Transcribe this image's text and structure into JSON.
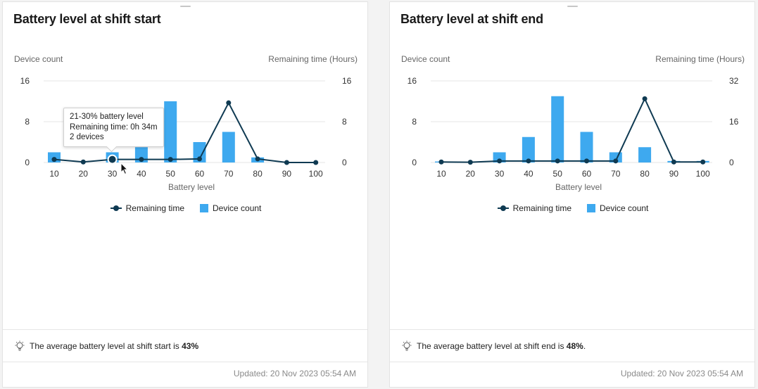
{
  "colors": {
    "bar": "#3ea9ef",
    "line": "#0f3a52",
    "axis_text": "#666666",
    "grid": "#e6e6e6"
  },
  "cards": [
    {
      "title": "Battery level at shift start",
      "chart_data": {
        "type": "bar",
        "x_axis_label": "Battery level",
        "left_axis_label": "Device count",
        "right_axis_label": "Remaining time (Hours)",
        "categories": [
          "10",
          "20",
          "30",
          "40",
          "50",
          "60",
          "70",
          "80",
          "90",
          "100"
        ],
        "left_ylim": [
          0,
          16
        ],
        "left_ticks": [
          "0",
          "8",
          "16"
        ],
        "right_ylim": [
          0,
          16
        ],
        "right_ticks": [
          "0",
          "8",
          "16"
        ],
        "series": [
          {
            "name": "Device count",
            "type": "bar",
            "axis": "left",
            "values": [
              2,
              0,
              2,
              3,
              12,
              4,
              6,
              1,
              0,
              0
            ]
          },
          {
            "name": "Remaining time",
            "type": "line",
            "axis": "right",
            "values": [
              0.6,
              0.1,
              0.6,
              0.6,
              0.6,
              0.7,
              11.7,
              0.7,
              0,
              0
            ]
          }
        ]
      },
      "legend": [
        "Remaining time",
        "Device count"
      ],
      "insight_prefix": "The average battery level at shift start is ",
      "insight_value": "43%",
      "insight_suffix": "",
      "updated": "Updated: 20 Nov 2023 05:54 AM",
      "tooltip": {
        "line1": "21-30% battery level",
        "line2": "Remaining time: 0h 34m",
        "line3": "2 devices"
      }
    },
    {
      "title": "Battery level at shift end",
      "chart_data": {
        "type": "bar",
        "x_axis_label": "Battery level",
        "left_axis_label": "Device count",
        "right_axis_label": "Remaining time (Hours)",
        "categories": [
          "10",
          "20",
          "30",
          "40",
          "50",
          "60",
          "70",
          "80",
          "90",
          "100"
        ],
        "left_ylim": [
          0,
          16
        ],
        "left_ticks": [
          "0",
          "8",
          "16"
        ],
        "right_ylim": [
          0,
          32
        ],
        "right_ticks": [
          "0",
          "16",
          "32"
        ],
        "series": [
          {
            "name": "Device count",
            "type": "bar",
            "axis": "left",
            "values": [
              0.2,
              0,
              2,
              5,
              13,
              6,
              2,
              3,
              0.3,
              0.3
            ]
          },
          {
            "name": "Remaining time",
            "type": "line",
            "axis": "right",
            "values": [
              0.2,
              0.1,
              0.6,
              0.6,
              0.6,
              0.6,
              0.6,
              25,
              0.2,
              0.2
            ]
          }
        ]
      },
      "legend": [
        "Remaining time",
        "Device count"
      ],
      "insight_prefix": "The average battery level at shift end is ",
      "insight_value": "48%",
      "insight_suffix": ".",
      "updated": "Updated: 20 Nov 2023 05:54 AM"
    }
  ]
}
